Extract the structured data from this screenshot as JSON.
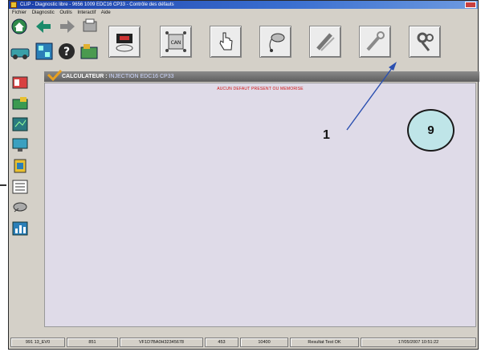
{
  "window": {
    "title": "CLIP - Diagnostic libre - 9656 1009 EDC16 CP33 - Contrôle des défauts"
  },
  "menu": [
    "Fichier",
    "Diagnostic",
    "Outils",
    "Interactif",
    "Aide"
  ],
  "calculator": {
    "label": "CALCULATEUR :",
    "name": "INJECTION EDC16 CP33"
  },
  "content": {
    "message": "AUCUN DEFAUT PRESENT OU MEMORISE"
  },
  "toolbar_icons": [
    "mute-icon",
    "can-bus-icon",
    "hand-pointer-icon",
    "probe-icon",
    "cable-icon",
    "wrench-icon",
    "settings-icon"
  ],
  "status": [
    "991 13_EV0",
    "851",
    "VF1D7BA0H32345678",
    "453",
    "10400",
    "Resultat Test OK",
    "17/05/2007 10:51:22"
  ],
  "annotation": {
    "label": "1",
    "circle": "9"
  },
  "colors": {
    "title_bar": "#1c3fa8",
    "calc_bar": "#6a6a6a",
    "message": "#d01010",
    "annotation_arrow": "#2a4fb0",
    "callout_fill": "#bfe5e8"
  }
}
